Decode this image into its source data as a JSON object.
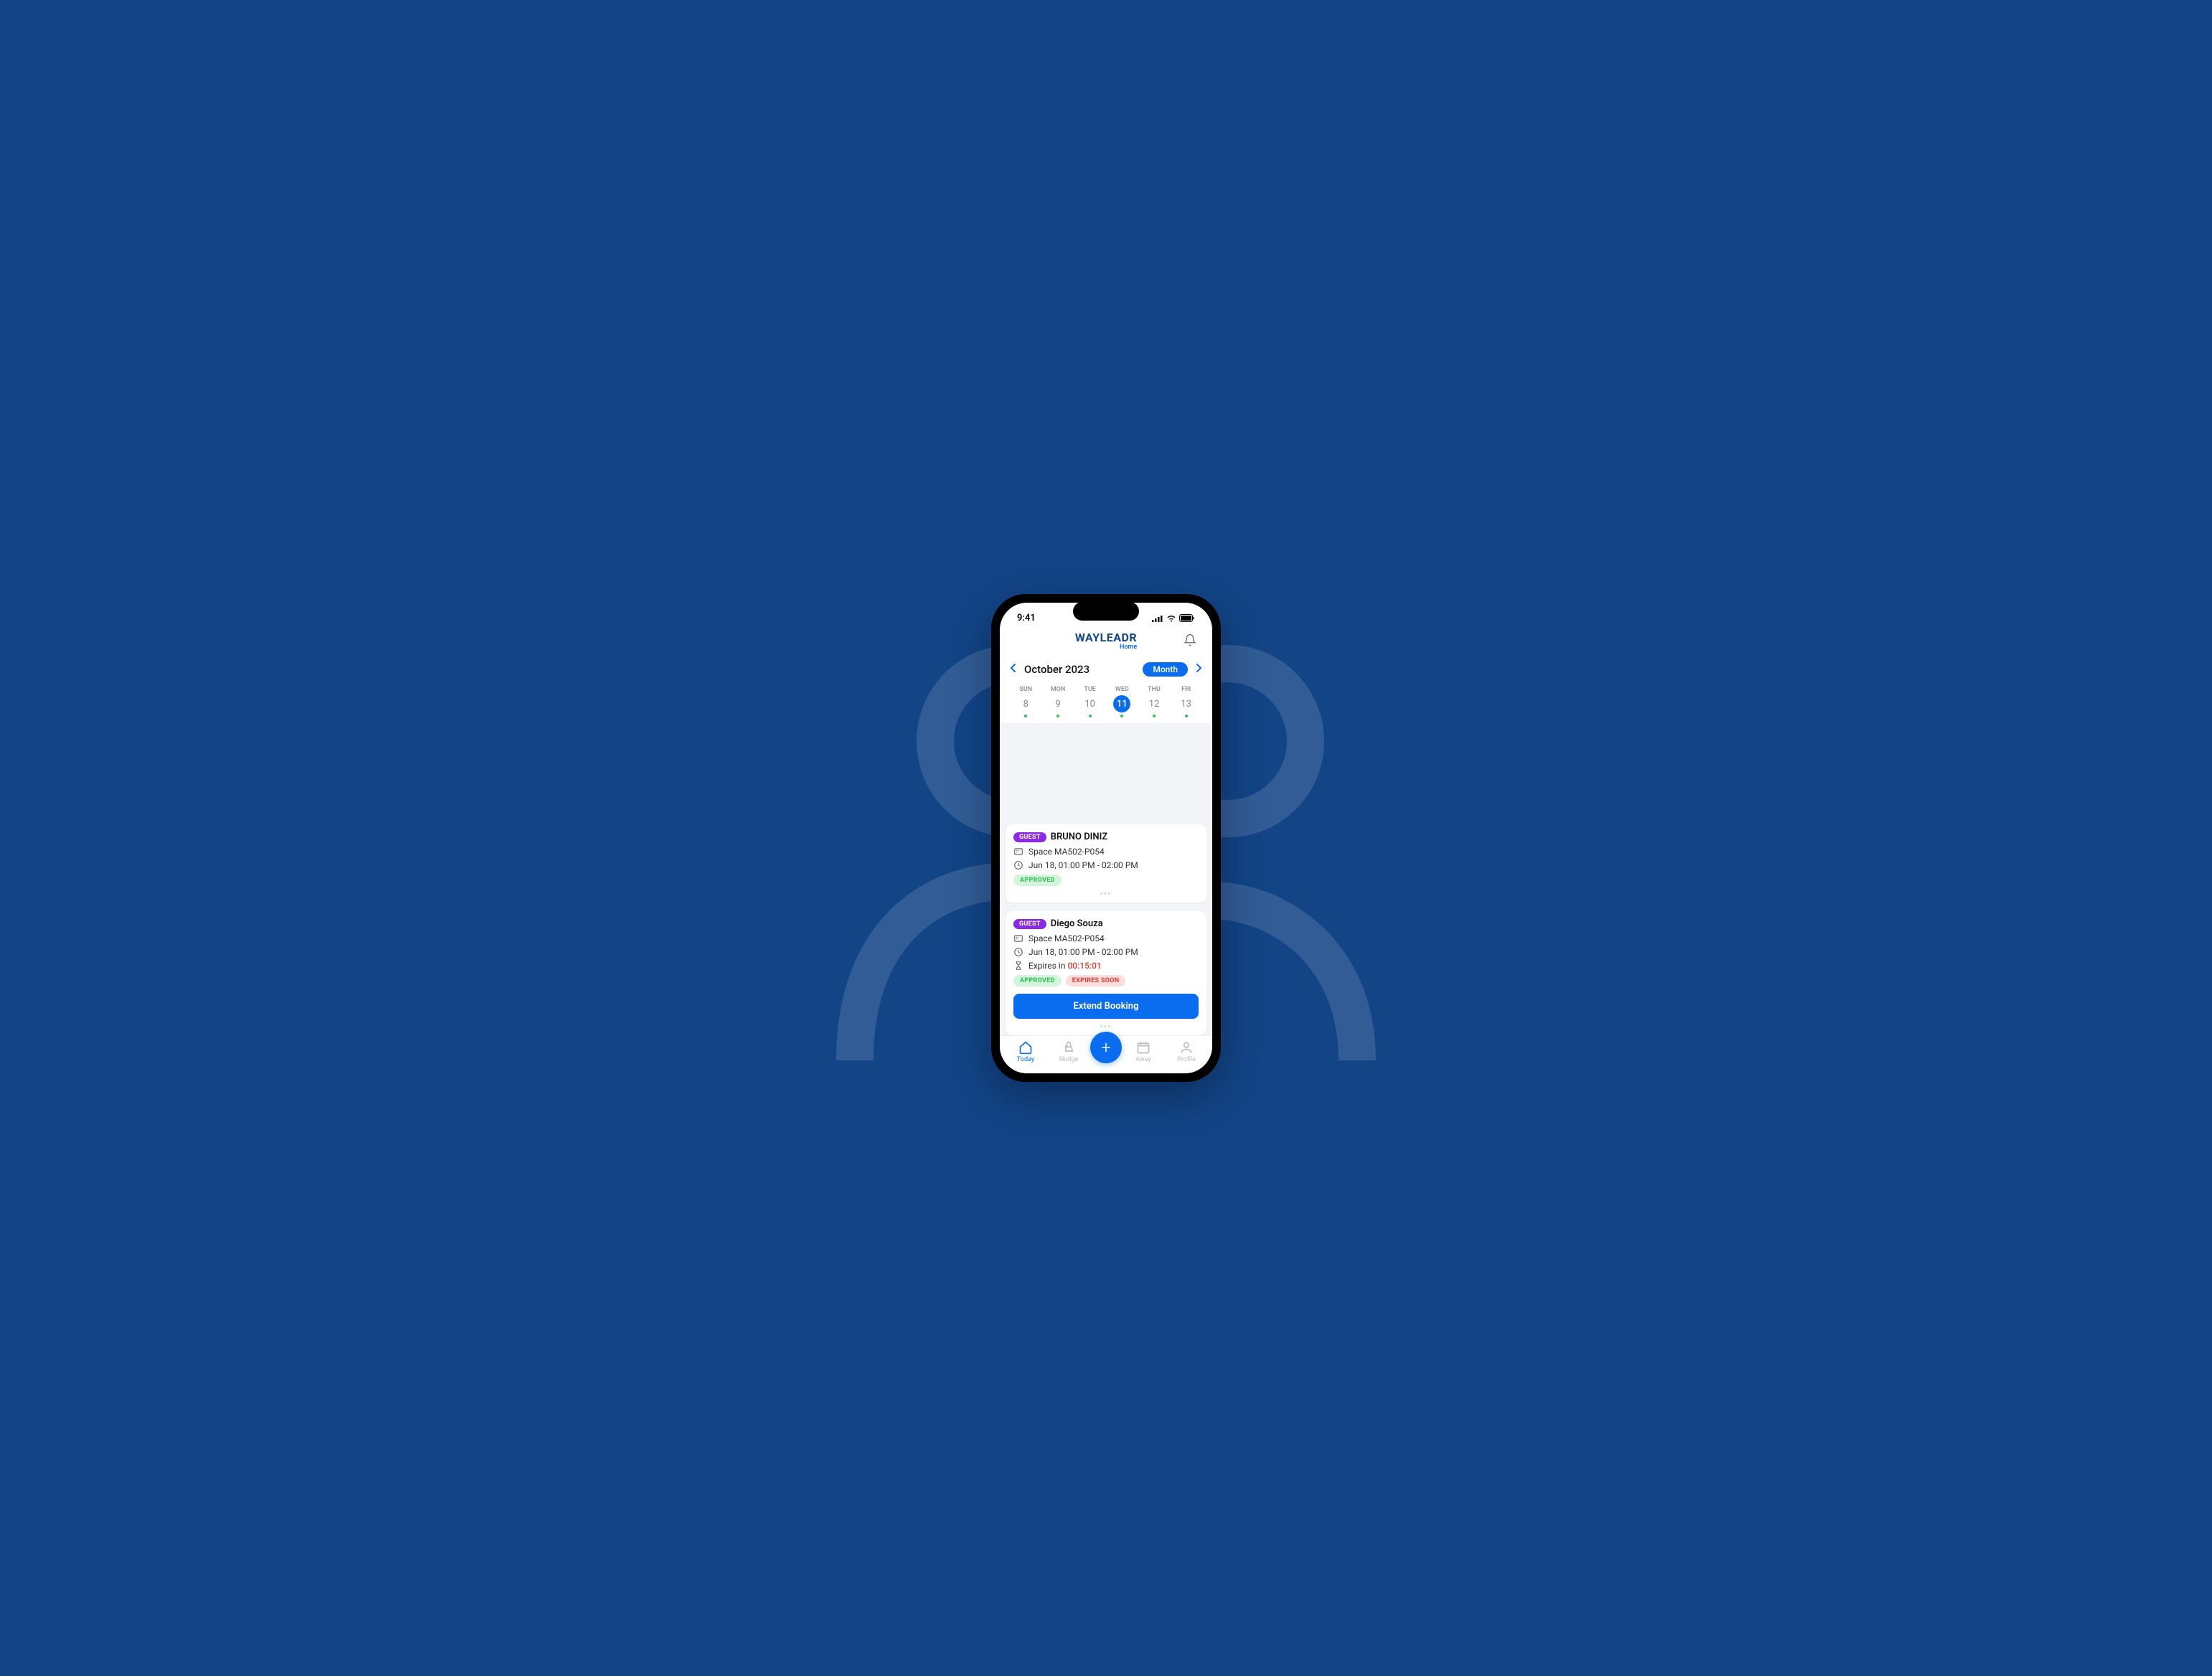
{
  "status_bar": {
    "time": "9:41"
  },
  "header": {
    "logo_main": "WAYLEADR",
    "logo_sub": "Home"
  },
  "month_nav": {
    "label": "October 2023",
    "pill": "Month"
  },
  "week": [
    {
      "name": "SUN",
      "num": "8",
      "selected": false
    },
    {
      "name": "MON",
      "num": "9",
      "selected": false
    },
    {
      "name": "TUE",
      "num": "10",
      "selected": false
    },
    {
      "name": "WED",
      "num": "11",
      "selected": true
    },
    {
      "name": "THU",
      "num": "12",
      "selected": false
    },
    {
      "name": "FRI",
      "num": "13",
      "selected": false
    }
  ],
  "cards": {
    "a": {
      "guest_label": "GUEST",
      "name": "BRUNO DINIZ",
      "space": "Space MA502-P054",
      "time": "Jun 18, 01:00 PM - 02:00 PM",
      "approved": "APPROVED"
    },
    "b": {
      "guest_label": "GUEST",
      "name": "Diego Souza",
      "space": "Space MA502-P054",
      "time": "Jun 18, 01:00 PM - 02:00 PM",
      "expires_label": "Expires in ",
      "expires_time": "00:15:01",
      "approved": "APPROVED",
      "expires_badge": "EXPIRES SOON",
      "extend_label": "Extend Booking"
    }
  },
  "tabbar": {
    "today": "Today",
    "nudge": "Nudge",
    "away": "Away",
    "profile": "Profile"
  }
}
